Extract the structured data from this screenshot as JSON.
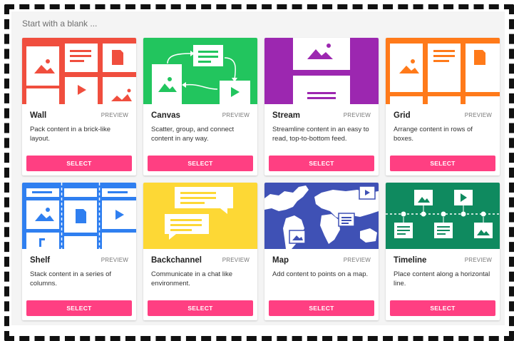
{
  "heading": "Start with a blank ...",
  "cards": [
    {
      "title": "Wall",
      "preview": "PREVIEW",
      "description": "Pack content in a brick-like layout.",
      "button": "SELECT",
      "color": "#f04e3e"
    },
    {
      "title": "Canvas",
      "preview": "PREVIEW",
      "description": "Scatter, group, and connect content in any way.",
      "button": "SELECT",
      "color": "#22c55e"
    },
    {
      "title": "Stream",
      "preview": "PREVIEW",
      "description": "Streamline content in an easy to read, top-to-bottom feed.",
      "button": "SELECT",
      "color": "#9c27b0"
    },
    {
      "title": "Grid",
      "preview": "PREVIEW",
      "description": "Arrange content in rows of boxes.",
      "button": "SELECT",
      "color": "#ff7a1a"
    },
    {
      "title": "Shelf",
      "preview": "PREVIEW",
      "description": "Stack content in a series of columns.",
      "button": "SELECT",
      "color": "#2f7ff0"
    },
    {
      "title": "Backchannel",
      "preview": "PREVIEW",
      "description": "Communicate in a chat like environment.",
      "button": "SELECT",
      "color": "#fdd835"
    },
    {
      "title": "Map",
      "preview": "PREVIEW",
      "description": "Add content to points on a map.",
      "button": "SELECT",
      "color": "#3f51b5"
    },
    {
      "title": "Timeline",
      "preview": "PREVIEW",
      "description": "Place content along a horizontal line.",
      "button": "SELECT",
      "color": "#0f8a5f"
    }
  ],
  "colors": {
    "accent": "#ff3f82"
  }
}
